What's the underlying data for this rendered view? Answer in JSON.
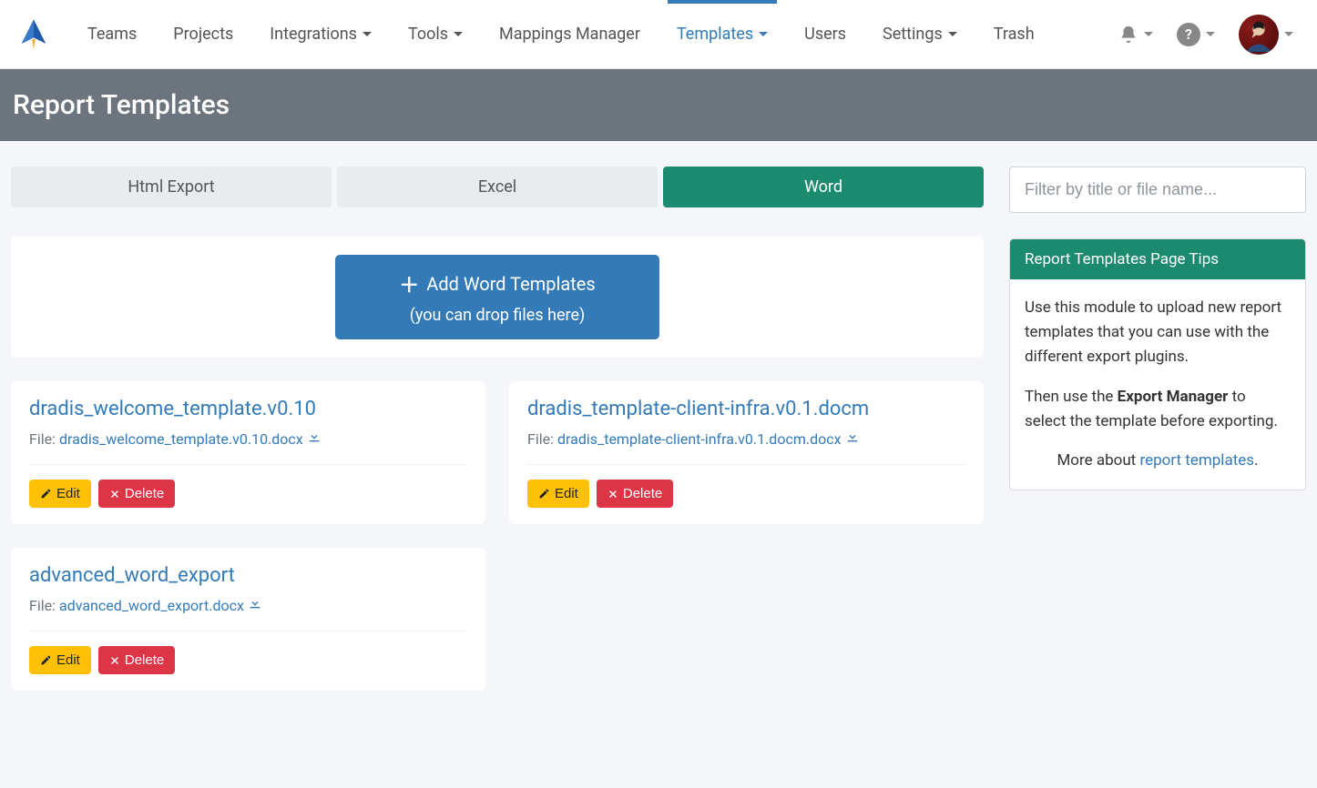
{
  "nav": {
    "items": [
      {
        "label": "Teams",
        "dropdown": false,
        "active": false
      },
      {
        "label": "Projects",
        "dropdown": false,
        "active": false
      },
      {
        "label": "Integrations",
        "dropdown": true,
        "active": false
      },
      {
        "label": "Tools",
        "dropdown": true,
        "active": false
      },
      {
        "label": "Mappings Manager",
        "dropdown": false,
        "active": false
      },
      {
        "label": "Templates",
        "dropdown": true,
        "active": true
      },
      {
        "label": "Users",
        "dropdown": false,
        "active": false
      },
      {
        "label": "Settings",
        "dropdown": true,
        "active": false
      },
      {
        "label": "Trash",
        "dropdown": false,
        "active": false
      }
    ]
  },
  "page_title": "Report Templates",
  "tabs": [
    {
      "label": "Html Export",
      "active": false
    },
    {
      "label": "Excel",
      "active": false
    },
    {
      "label": "Word",
      "active": true
    }
  ],
  "upload": {
    "main": "Add Word Templates",
    "sub": "(you can drop files here)"
  },
  "templates": [
    {
      "title": "dradis_welcome_template.v0.10",
      "file_prefix": "File: ",
      "file": "dradis_welcome_template.v0.10.docx"
    },
    {
      "title": "dradis_template-client-infra.v0.1.docm",
      "file_prefix": "File: ",
      "file": "dradis_template-client-infra.v0.1.docm.docx"
    },
    {
      "title": "advanced_word_export",
      "file_prefix": "File: ",
      "file": "advanced_word_export.docx"
    }
  ],
  "buttons": {
    "edit": "Edit",
    "delete": "Delete"
  },
  "filter": {
    "placeholder": "Filter by title or file name..."
  },
  "tips": {
    "header": "Report Templates Page Tips",
    "p1": "Use this module to upload new report templates that you can use with the different export plugins.",
    "p2_pre": "Then use the ",
    "p2_strong": "Export Manager",
    "p2_post": " to select the template before exporting.",
    "more_pre": "More about ",
    "more_link": "report templates",
    "more_post": "."
  }
}
